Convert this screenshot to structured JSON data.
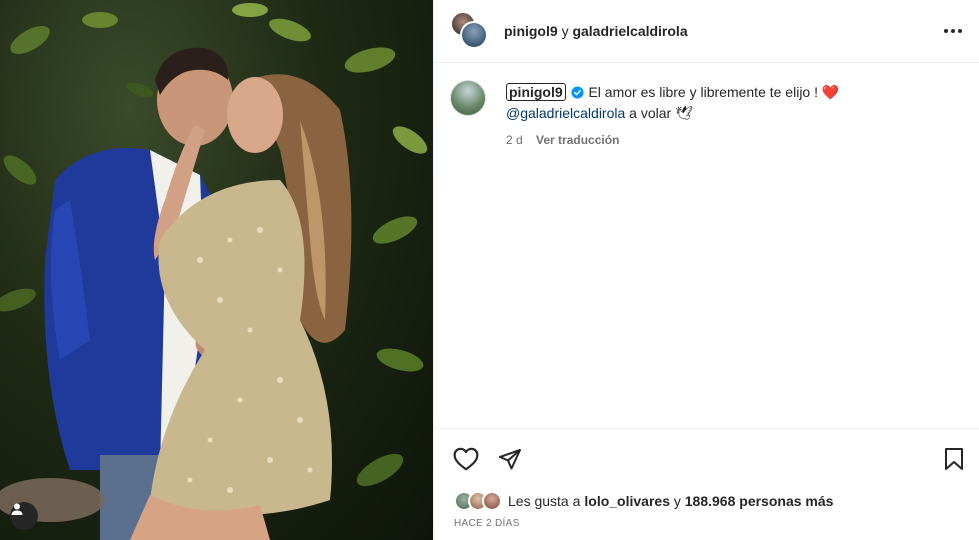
{
  "header": {
    "user1": "pinigol9",
    "joiner": "y",
    "user2": "galadrielcaldirola"
  },
  "caption": {
    "username": "pinigol9",
    "text": "El amor es libre y libremente te elijo ! ",
    "heart_emoji": "❤️",
    "mention": "@galadrielcaldirola",
    "text2": " a volar ",
    "dove_emoji": "🕊",
    "age": "2 d",
    "translate": "Ver traducción"
  },
  "likes": {
    "prefix": "Les gusta a ",
    "user": "lolo_olivares",
    "middle": " y ",
    "count": "188.968 personas más"
  },
  "date": "HACE 2 DÍAS",
  "colors": {
    "verified": "#0095f6",
    "mention": "#00376b",
    "heart": "#e0245e"
  }
}
